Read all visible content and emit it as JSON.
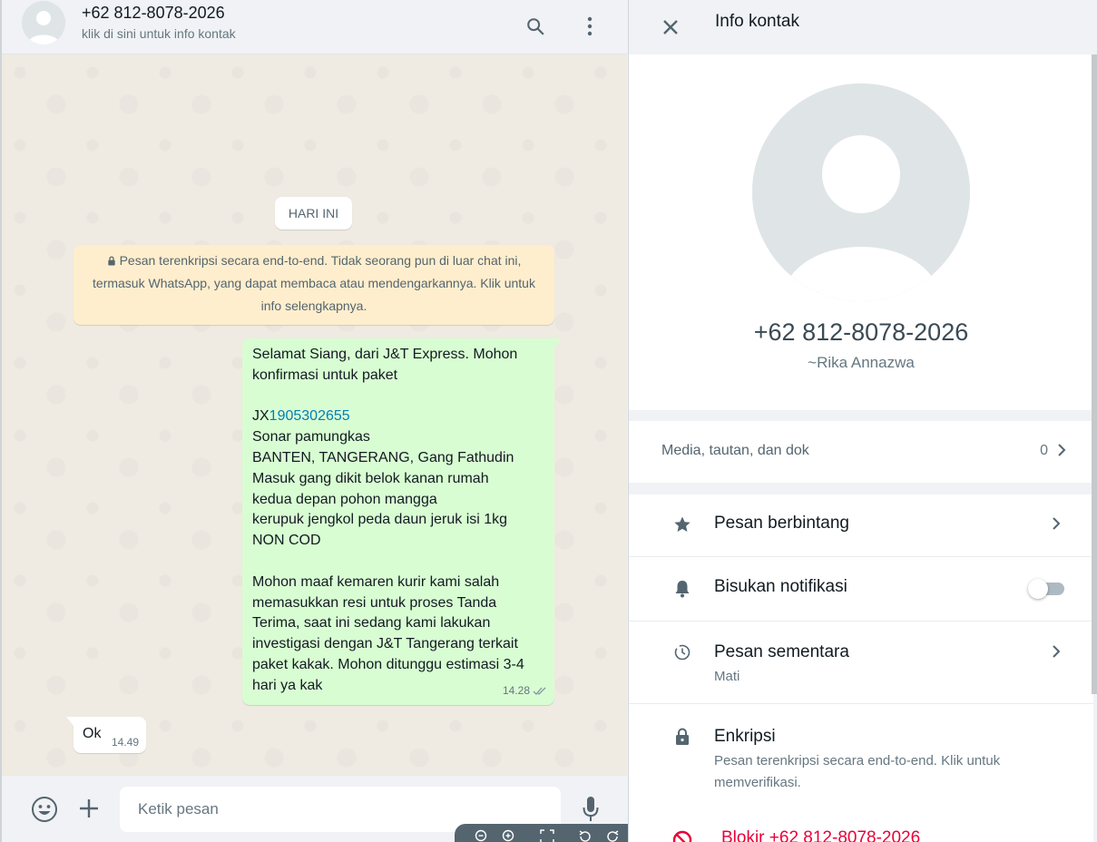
{
  "chat": {
    "header": {
      "contact_phone": "+62 812-8078-2026",
      "contact_hint": "klik di sini untuk info kontak"
    },
    "date_chip": "HARI INI",
    "encryption_notice": "Pesan terenkripsi secara end-to-end. Tidak seorang pun di luar chat ini, termasuk WhatsApp, yang dapat membaca atau mendengarkannya. Klik untuk info selengkapnya.",
    "outgoing_message": {
      "lines": [
        "Selamat Siang, dari J&T Express. Mohon",
        "konfirmasi untuk paket",
        "",
        "JX",
        "Sonar pamungkas",
        "BANTEN, TANGERANG, Gang Fathudin",
        "Masuk gang dikit belok kanan rumah",
        "kedua depan pohon mangga",
        "kerupuk jengkol peda daun jeruk isi 1kg",
        "NON COD",
        "",
        "Mohon maaf kemaren kurir kami salah",
        "memasukkan resi untuk proses Tanda",
        "Terima, saat ini sedang kami lakukan",
        "investigasi dengan J&T Tangerang terkait",
        "paket kakak. Mohon ditunggu estimasi 3-4",
        "hari ya kak"
      ],
      "tracking_link": "1905302655",
      "time": "14.28"
    },
    "incoming_message": {
      "text": "Ok",
      "time": "14.49"
    },
    "composer": {
      "placeholder": "Ketik pesan"
    }
  },
  "contact_info": {
    "title": "Info kontak",
    "phone": "+62 812-8078-2026",
    "push_name": "~Rika Annazwa",
    "media": {
      "label": "Media, tautan, dan dok",
      "count": "0"
    },
    "options": {
      "starred": "Pesan berbintang",
      "mute": "Bisukan notifikasi",
      "mute_enabled": false,
      "disappearing": "Pesan sementara",
      "disappearing_value": "Mati",
      "encryption": "Enkripsi",
      "encryption_desc": "Pesan terenkripsi secara end-to-end. Klik untuk memverifikasi.",
      "block": "Blokir +62 812-8078-2026"
    }
  },
  "icons": {
    "search": "search-icon",
    "menu": "menu-icon",
    "close": "close-icon",
    "emoji": "emoji-icon",
    "attach": "plus-icon",
    "mic": "mic-icon",
    "star": "star-icon",
    "bell": "bell-icon",
    "timer": "timer-icon",
    "lock": "lock-icon",
    "block": "block-icon"
  },
  "colors": {
    "outgoing_bubble": "#d9fdd3",
    "notice_bubble": "#ffeecd",
    "link": "#027eb5",
    "danger": "#ea0038"
  }
}
